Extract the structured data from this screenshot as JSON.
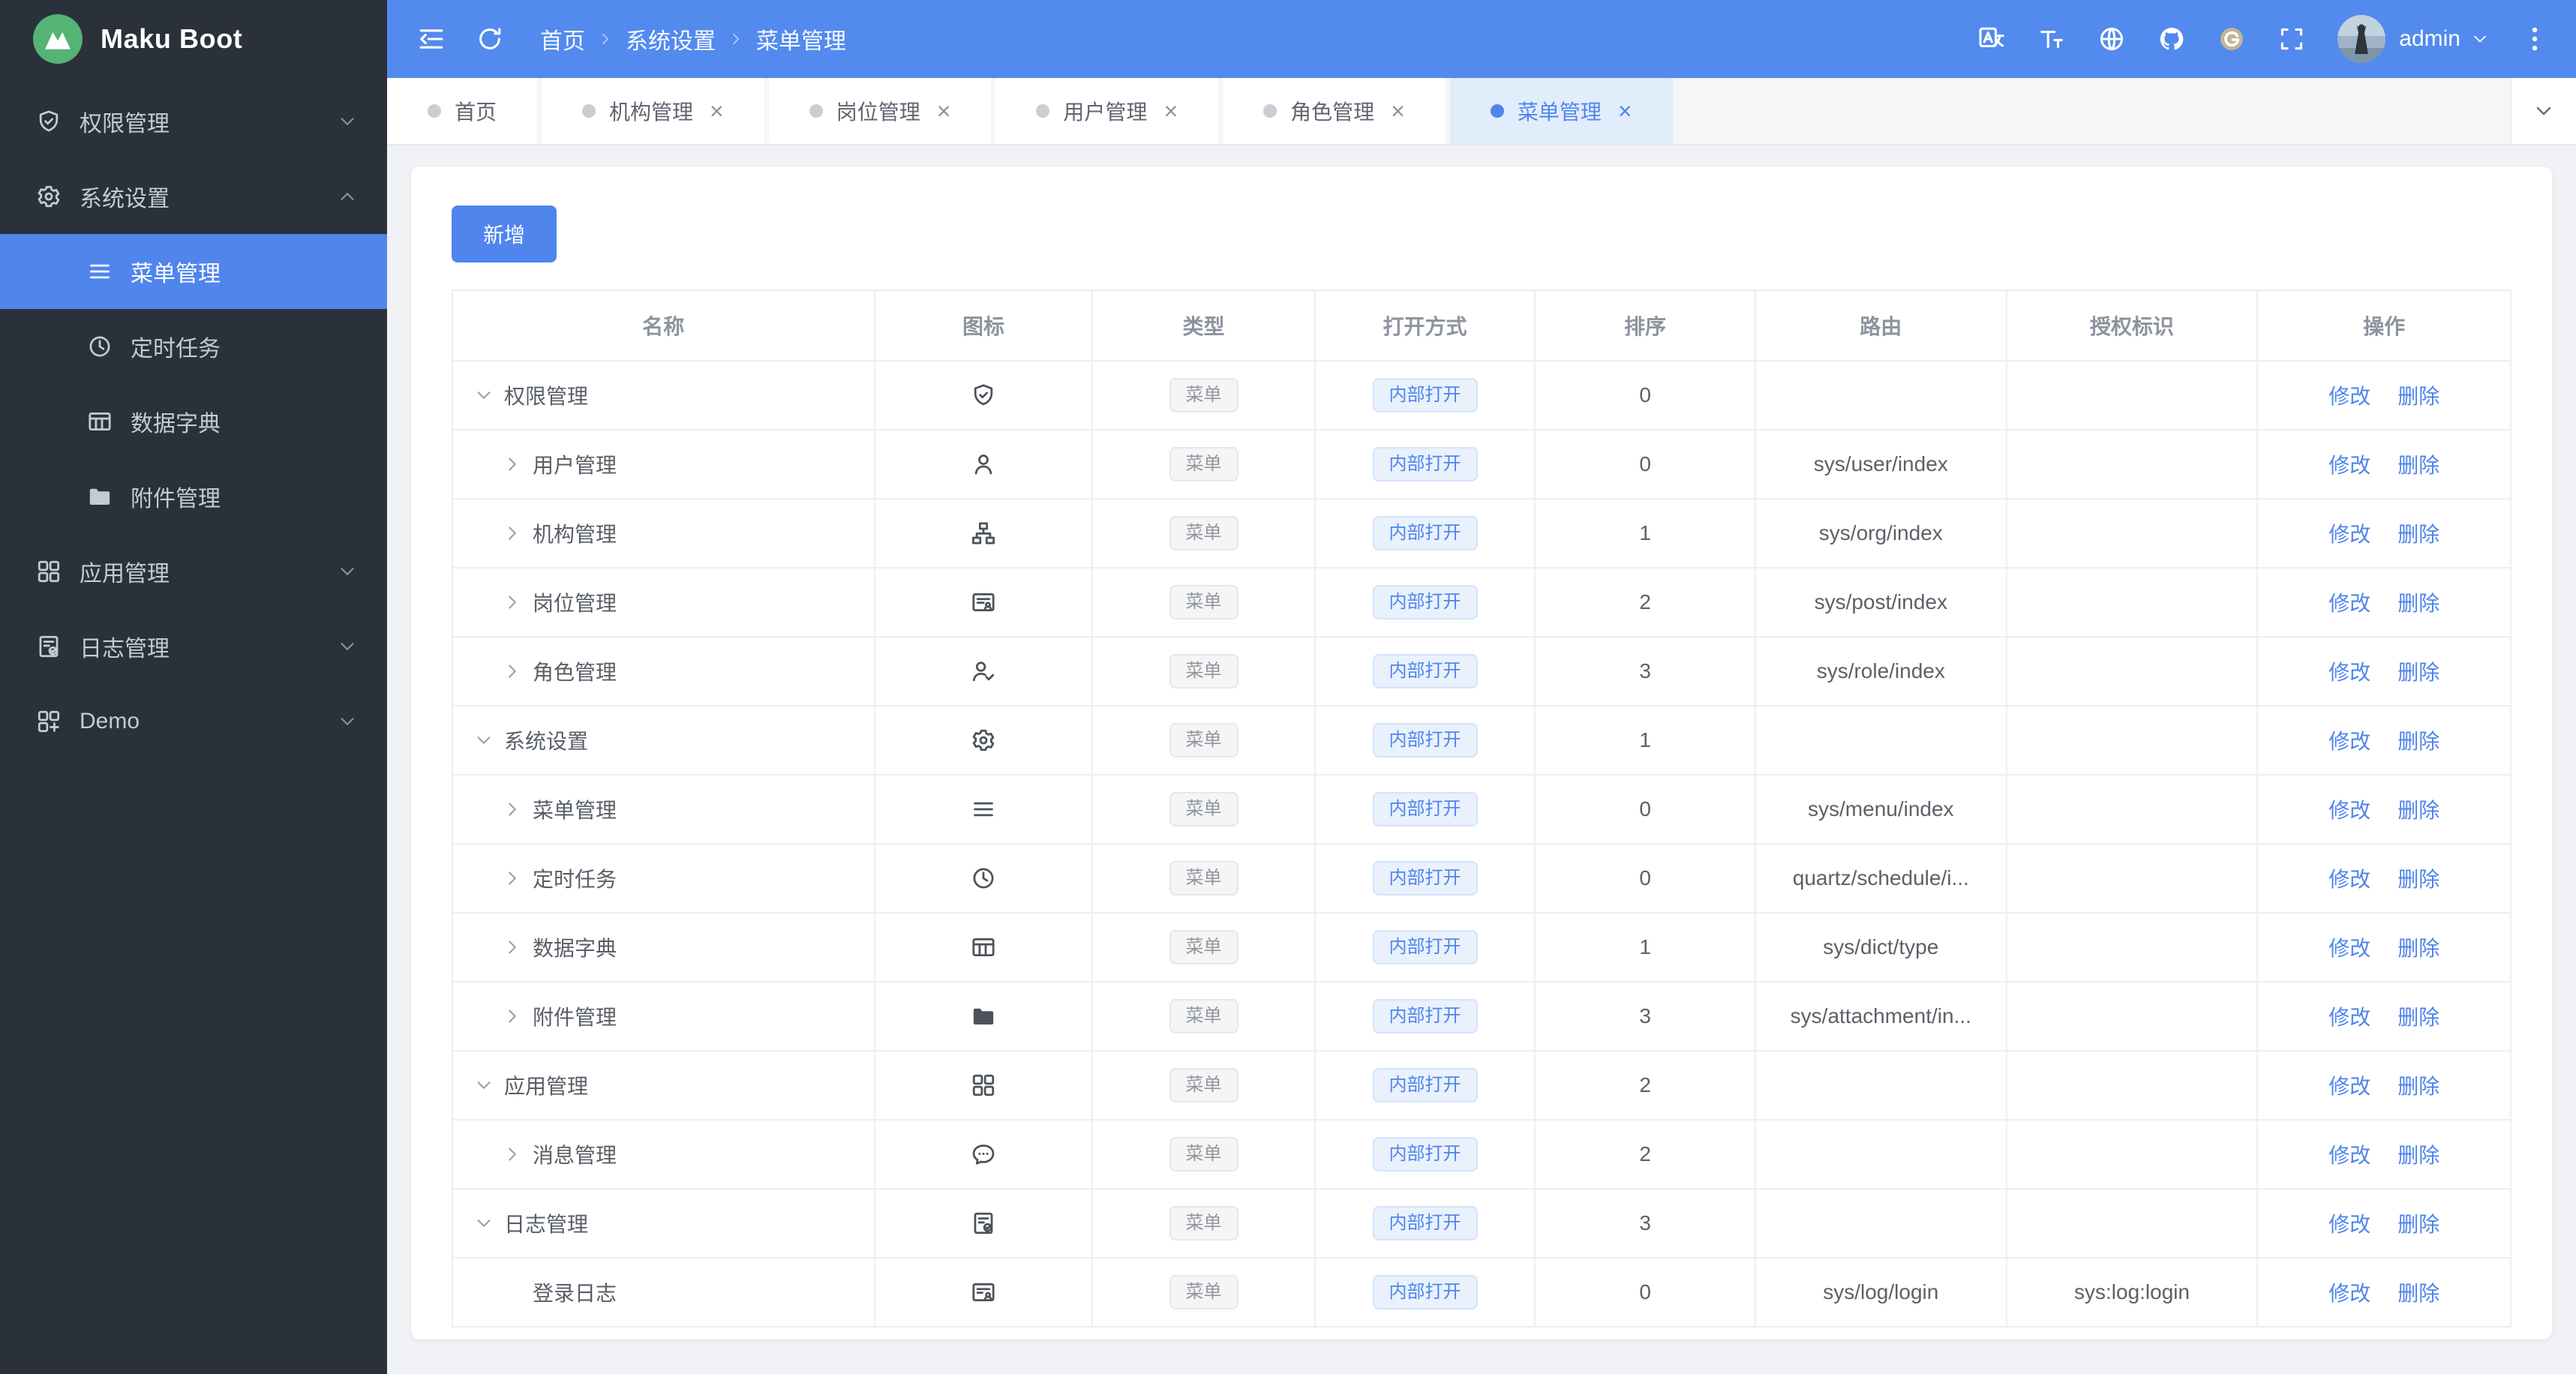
{
  "app": {
    "title": "Maku Boot",
    "logo_icon": "logo"
  },
  "colors": {
    "primary": "#4f85ec",
    "header_bg": "#528aee",
    "sidebar_bg": "#2a313a",
    "sidebar_text": "#c5cbd3",
    "active_tab_bg": "#e2edfc",
    "content_bg": "#f0f2f5",
    "tag_info_bg": "#f5f5f6",
    "tag_info_text": "#8f959e",
    "tag_primary_bg": "#e9f1fd",
    "tag_primary_text": "#4f85ec",
    "link": "#4f85ec",
    "table_border": "#ebeef5",
    "logo_green": "#55b376",
    "gitee_gold": "#c0b596"
  },
  "header": {
    "collapse_icon": "fold",
    "refresh_icon": "refresh",
    "breadcrumb": [
      "首页",
      "系统设置",
      "菜单管理"
    ],
    "action_icons": [
      "translate",
      "font-size",
      "globe",
      "github",
      "gitee",
      "fullscreen"
    ],
    "user": {
      "name": "admin",
      "caret_icon": "chevron-down",
      "menu_icon": "more"
    }
  },
  "tabs": [
    {
      "label": "首页",
      "closable": false,
      "active": false
    },
    {
      "label": "机构管理",
      "closable": true,
      "active": false
    },
    {
      "label": "岗位管理",
      "closable": true,
      "active": false
    },
    {
      "label": "用户管理",
      "closable": true,
      "active": false
    },
    {
      "label": "角色管理",
      "closable": true,
      "active": false
    },
    {
      "label": "菜单管理",
      "closable": true,
      "active": true
    }
  ],
  "sidebar": {
    "items": [
      {
        "label": "权限管理",
        "icon": "shield",
        "expanded": false,
        "children": []
      },
      {
        "label": "系统设置",
        "icon": "gear",
        "expanded": true,
        "children": [
          {
            "label": "菜单管理",
            "icon": "menu",
            "active": true
          },
          {
            "label": "定时任务",
            "icon": "clock",
            "active": false
          },
          {
            "label": "数据字典",
            "icon": "dict",
            "active": false
          },
          {
            "label": "附件管理",
            "icon": "folder",
            "active": false
          }
        ]
      },
      {
        "label": "应用管理",
        "icon": "grid",
        "expanded": false,
        "children": []
      },
      {
        "label": "日志管理",
        "icon": "log",
        "expanded": false,
        "children": []
      },
      {
        "label": "Demo",
        "icon": "demo",
        "expanded": false,
        "children": []
      }
    ]
  },
  "toolbar": {
    "add_label": "新增"
  },
  "table": {
    "headers": [
      "名称",
      "图标",
      "类型",
      "打开方式",
      "排序",
      "路由",
      "授权标识",
      "操作"
    ],
    "action_labels": [
      "修改",
      "删除"
    ],
    "rows": [
      {
        "name": "权限管理",
        "icon": "shield",
        "level": 0,
        "caret": "down",
        "type": "菜单",
        "open": "内部打开",
        "sort": "0",
        "route": "",
        "perm": ""
      },
      {
        "name": "用户管理",
        "icon": "user",
        "level": 1,
        "caret": "right",
        "type": "菜单",
        "open": "内部打开",
        "sort": "0",
        "route": "sys/user/index",
        "perm": ""
      },
      {
        "name": "机构管理",
        "icon": "org",
        "level": 1,
        "caret": "right",
        "type": "菜单",
        "open": "内部打开",
        "sort": "1",
        "route": "sys/org/index",
        "perm": ""
      },
      {
        "name": "岗位管理",
        "icon": "post",
        "level": 1,
        "caret": "right",
        "type": "菜单",
        "open": "内部打开",
        "sort": "2",
        "route": "sys/post/index",
        "perm": ""
      },
      {
        "name": "角色管理",
        "icon": "role",
        "level": 1,
        "caret": "right",
        "type": "菜单",
        "open": "内部打开",
        "sort": "3",
        "route": "sys/role/index",
        "perm": ""
      },
      {
        "name": "系统设置",
        "icon": "gear",
        "level": 0,
        "caret": "down",
        "type": "菜单",
        "open": "内部打开",
        "sort": "1",
        "route": "",
        "perm": ""
      },
      {
        "name": "菜单管理",
        "icon": "menu",
        "level": 1,
        "caret": "right",
        "type": "菜单",
        "open": "内部打开",
        "sort": "0",
        "route": "sys/menu/index",
        "perm": ""
      },
      {
        "name": "定时任务",
        "icon": "clock",
        "level": 1,
        "caret": "right",
        "type": "菜单",
        "open": "内部打开",
        "sort": "0",
        "route": "quartz/schedule/i...",
        "perm": ""
      },
      {
        "name": "数据字典",
        "icon": "dict",
        "level": 1,
        "caret": "right",
        "type": "菜单",
        "open": "内部打开",
        "sort": "1",
        "route": "sys/dict/type",
        "perm": ""
      },
      {
        "name": "附件管理",
        "icon": "folder",
        "level": 1,
        "caret": "right",
        "type": "菜单",
        "open": "内部打开",
        "sort": "3",
        "route": "sys/attachment/in...",
        "perm": ""
      },
      {
        "name": "应用管理",
        "icon": "grid",
        "level": 0,
        "caret": "down",
        "type": "菜单",
        "open": "内部打开",
        "sort": "2",
        "route": "",
        "perm": ""
      },
      {
        "name": "消息管理",
        "icon": "message",
        "level": 1,
        "caret": "right",
        "type": "菜单",
        "open": "内部打开",
        "sort": "2",
        "route": "",
        "perm": ""
      },
      {
        "name": "日志管理",
        "icon": "log",
        "level": 0,
        "caret": "down",
        "type": "菜单",
        "open": "内部打开",
        "sort": "3",
        "route": "",
        "perm": ""
      },
      {
        "name": "登录日志",
        "icon": "loginlog",
        "level": 1,
        "caret": "none",
        "type": "菜单",
        "open": "内部打开",
        "sort": "0",
        "route": "sys/log/login",
        "perm": "sys:log:login"
      }
    ]
  }
}
